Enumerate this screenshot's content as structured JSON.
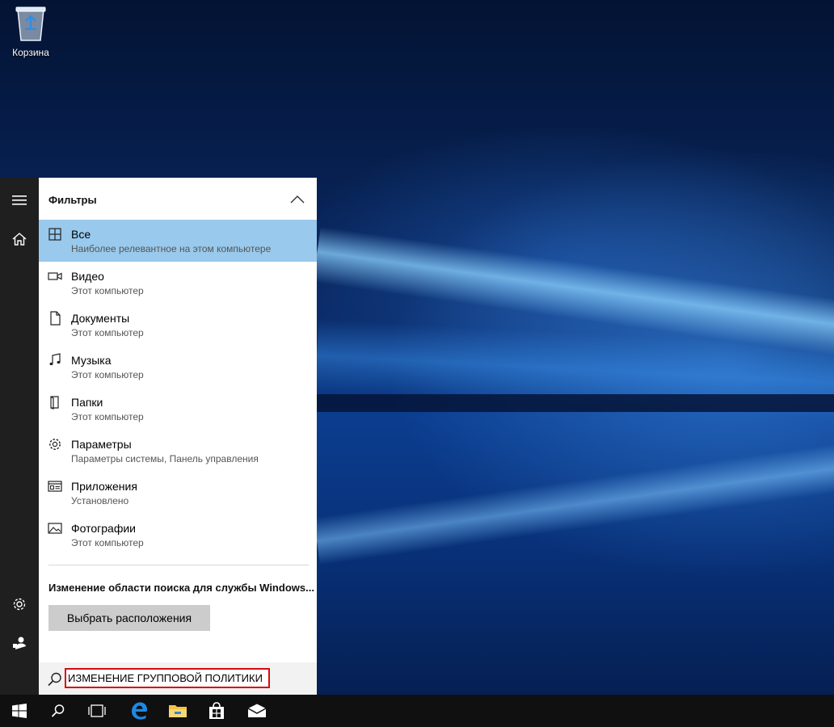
{
  "desktop": {
    "recycle_bin_label": "Корзина",
    "recycle_bin_icon": "recycle-bin-icon"
  },
  "start_menu": {
    "rail": {
      "top_items": [
        {
          "name": "hamburger-icon"
        },
        {
          "name": "home-icon"
        }
      ],
      "bottom_items": [
        {
          "name": "settings-icon"
        },
        {
          "name": "user-icon"
        }
      ]
    },
    "filters_title": "Фильтры",
    "filters": [
      {
        "title": "Все",
        "subtitle": "Наиболее релевантное на этом компьютере",
        "icon": "grid-icon",
        "selected": true
      },
      {
        "title": "Видео",
        "subtitle": "Этот компьютер",
        "icon": "video-icon",
        "selected": false
      },
      {
        "title": "Документы",
        "subtitle": "Этот компьютер",
        "icon": "document-icon",
        "selected": false
      },
      {
        "title": "Музыка",
        "subtitle": "Этот компьютер",
        "icon": "music-icon",
        "selected": false
      },
      {
        "title": "Папки",
        "subtitle": "Этот компьютер",
        "icon": "folder-icon",
        "selected": false
      },
      {
        "title": "Параметры",
        "subtitle": "Параметры системы, Панель управления",
        "icon": "gear-icon",
        "selected": false
      },
      {
        "title": "Приложения",
        "subtitle": "Установлено",
        "icon": "apps-icon",
        "selected": false
      },
      {
        "title": "Фотографии",
        "subtitle": "Этот компьютер",
        "icon": "photo-icon",
        "selected": false
      }
    ],
    "scope_text": "Изменение области поиска для службы Windows...",
    "pick_button_label": "Выбрать расположения",
    "search_value": "ИЗМЕНЕНИЕ ГРУППОВОЙ ПОЛИТИКИ",
    "selected_color": "#99c9ec",
    "highlight_color": "#d40d0d"
  },
  "taskbar": {
    "items": [
      "windows-start-icon",
      "search-icon",
      "task-view-icon",
      "edge-icon",
      "file-explorer-icon",
      "store-icon",
      "mail-icon"
    ]
  }
}
